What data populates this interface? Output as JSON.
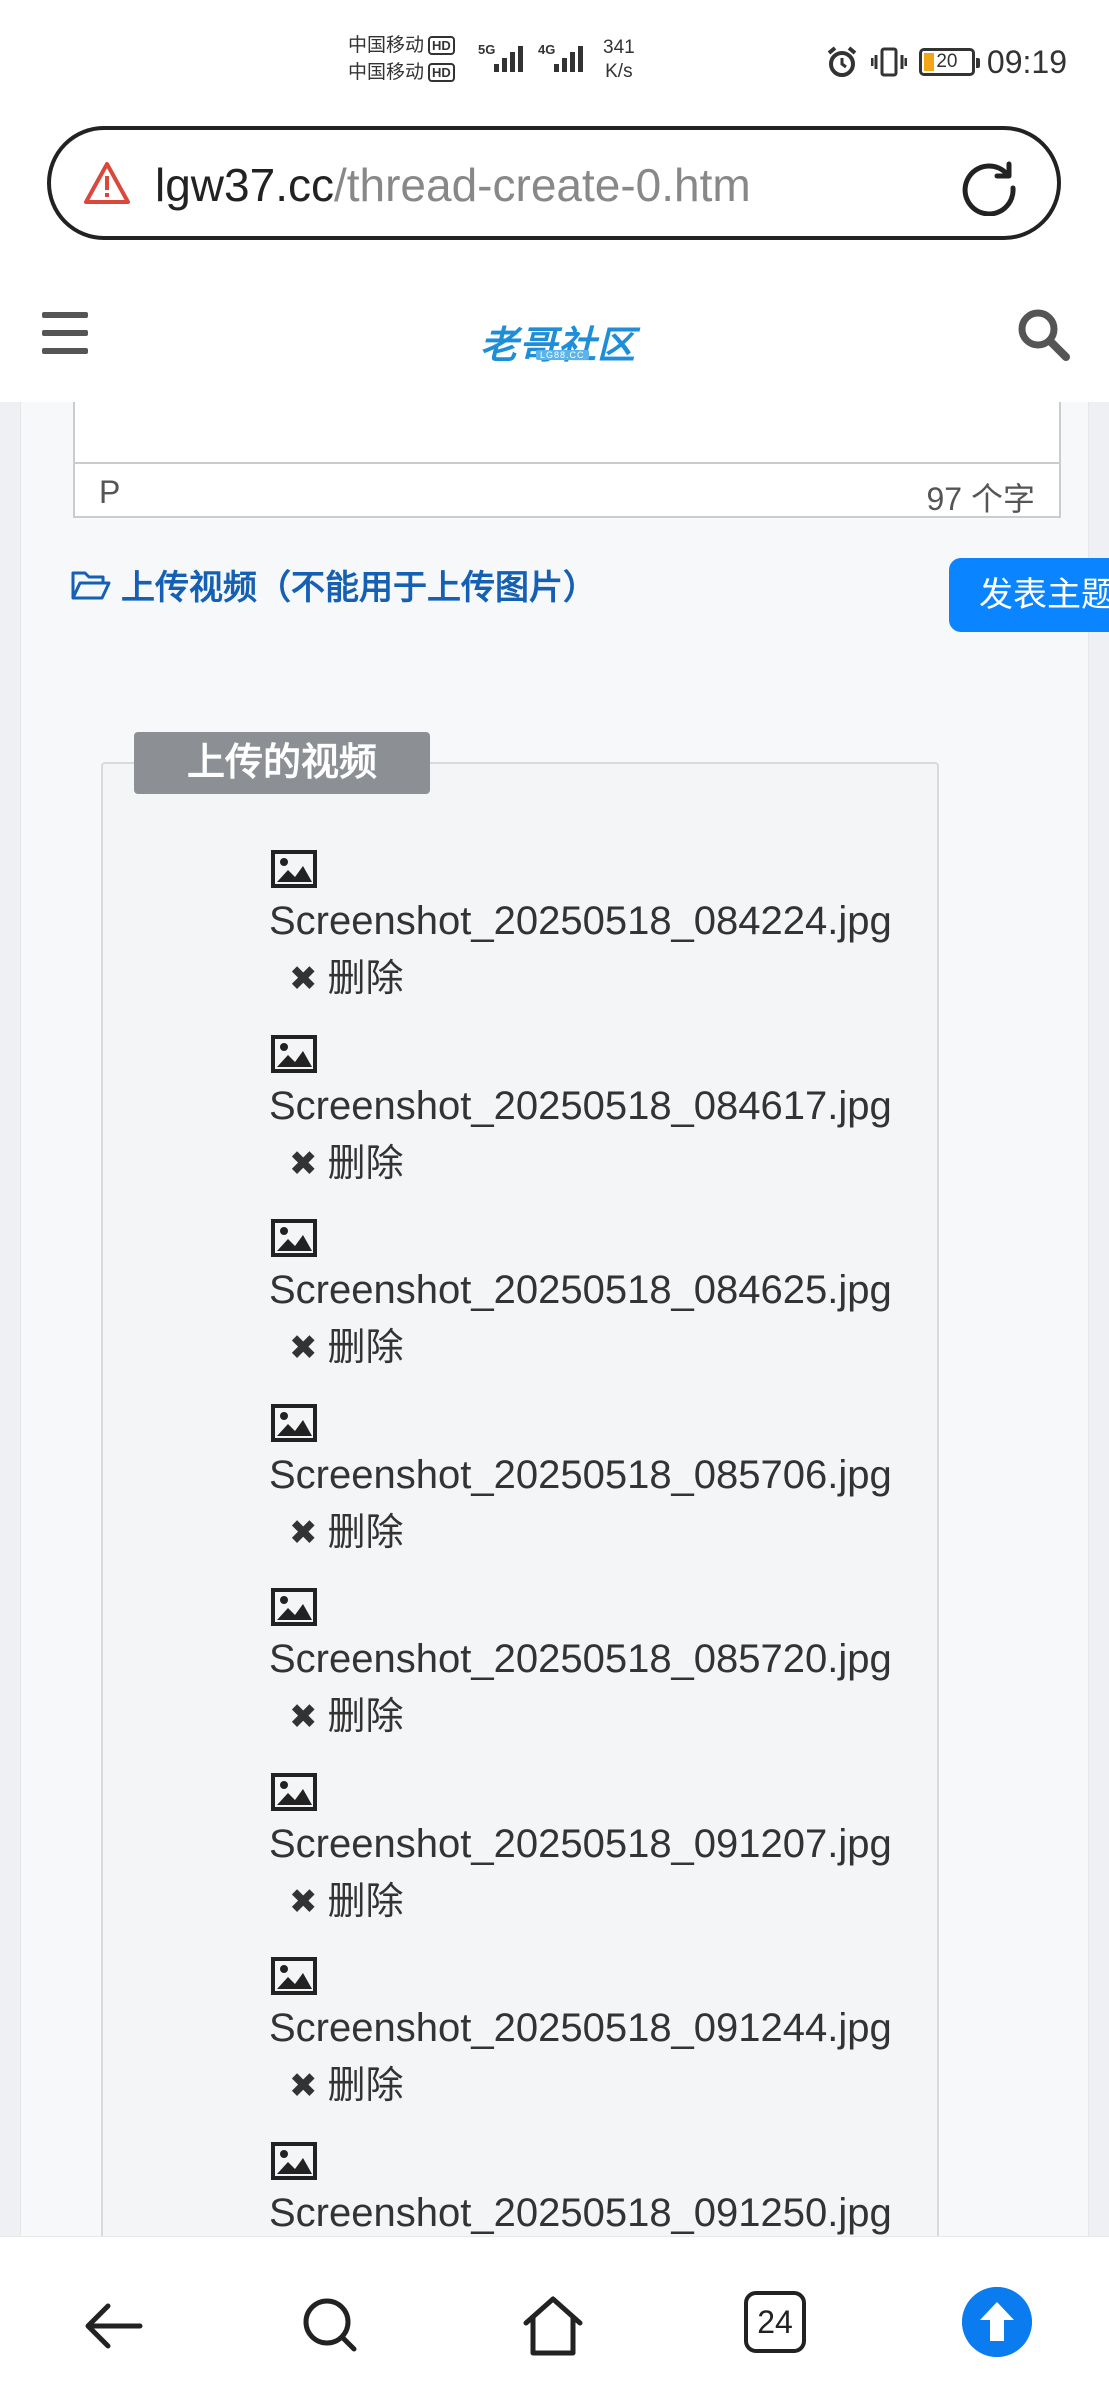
{
  "status_bar": {
    "carrier_1": "中国移动",
    "carrier_2": "中国移动",
    "hd_label": "HD",
    "net_5g": "5G",
    "net_4g": "4G",
    "net_speed_value": "341",
    "net_speed_unit": "K/s",
    "battery": "20",
    "time": "09:19"
  },
  "browser": {
    "url_host": "lgw37.cc",
    "url_path": "/thread-create-0.htm"
  },
  "site": {
    "logo_text": "老哥社区",
    "logo_sub": "LG88.CC"
  },
  "editor": {
    "tag": "P",
    "char_count": "97 个字"
  },
  "upload": {
    "link_label": "上传视频（不能用于上传图片）",
    "post_button": "发表主题",
    "legend": "上传的视频",
    "delete_label": "删除",
    "files": [
      "Screenshot_20250518_084224.jpg",
      "Screenshot_20250518_084617.jpg",
      "Screenshot_20250518_084625.jpg",
      "Screenshot_20250518_085706.jpg",
      "Screenshot_20250518_085720.jpg",
      "Screenshot_20250518_091207.jpg",
      "Screenshot_20250518_091244.jpg",
      "Screenshot_20250518_091250.jpg"
    ]
  },
  "bottom_nav": {
    "tabs_count": "24"
  },
  "colors": {
    "accent": "#0a84ff",
    "link": "#1560b3",
    "logo": "#1f8ed8",
    "warning": "#d9483b"
  }
}
